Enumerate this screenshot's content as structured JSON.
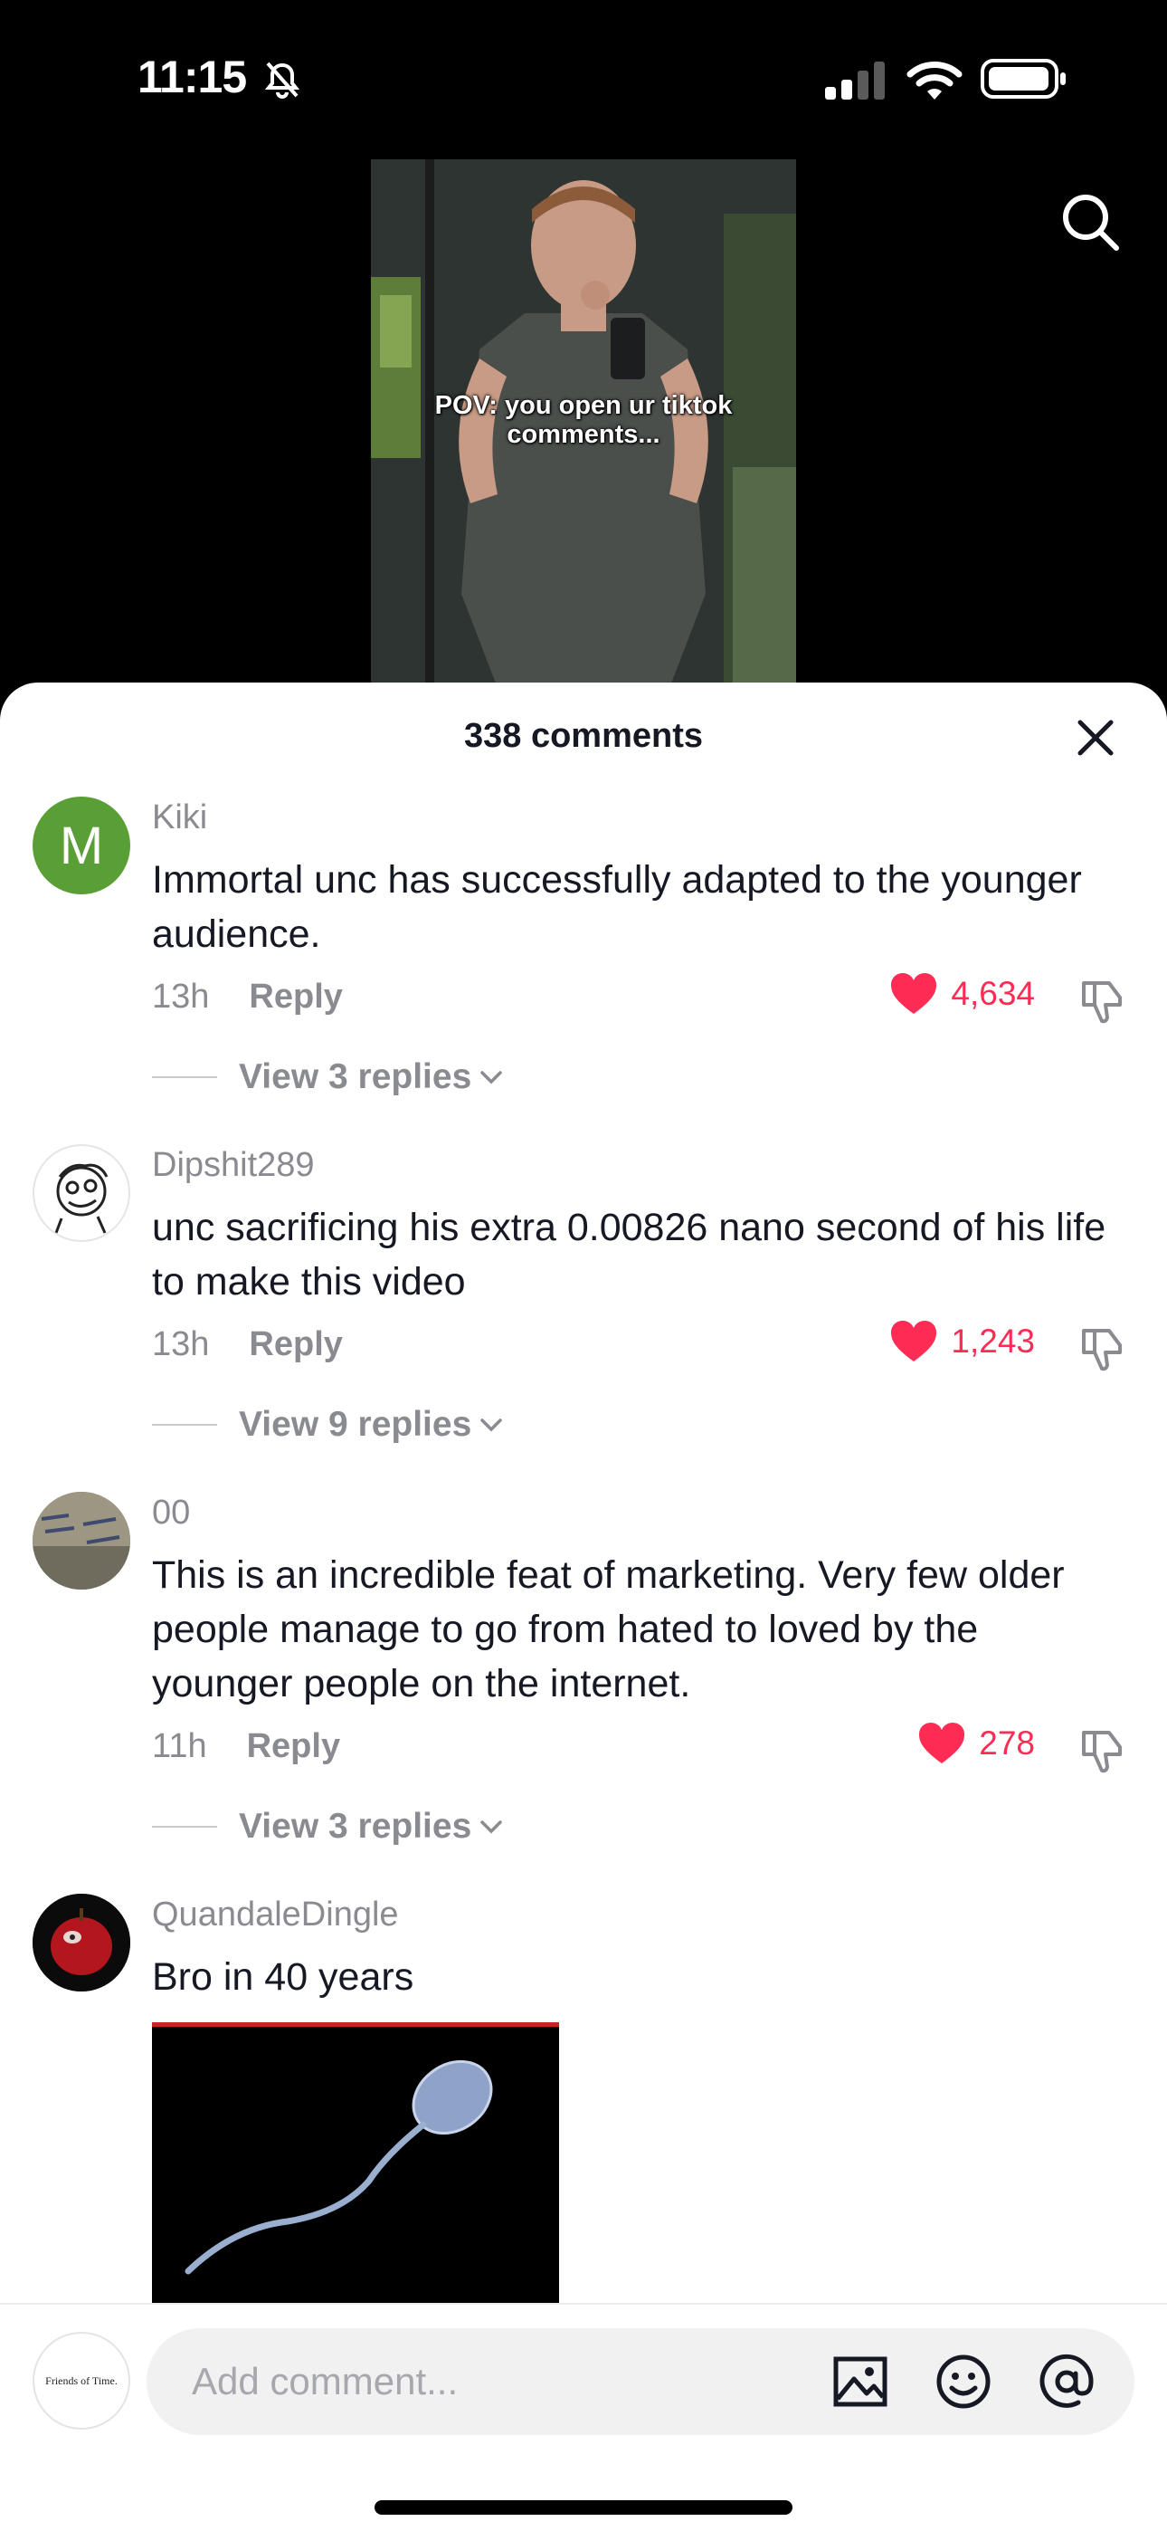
{
  "status_bar": {
    "time": "11:15"
  },
  "video": {
    "caption": "POV: you open ur tiktok comments..."
  },
  "sheet": {
    "title": "338 comments"
  },
  "comments": [
    {
      "username": "Kiki",
      "avatar_letter": "M",
      "avatar_color": "#5a9e36",
      "text": "Immortal unc has successfully adapted to the younger audience.",
      "age": "13h",
      "reply_label": "Reply",
      "likes": "4,634",
      "view_replies": "View 3 replies"
    },
    {
      "username": "Dipshit289",
      "text": "unc sacrificing his extra 0.00826 nano second of his life to make this video",
      "age": "13h",
      "reply_label": "Reply",
      "likes": "1,243",
      "view_replies": "View 9 replies"
    },
    {
      "username": "00",
      "text": "This is an incredible feat of marketing. Very few older people manage to go from hated to loved by the younger people on the internet.",
      "age": "11h",
      "reply_label": "Reply",
      "likes": "278",
      "view_replies": "View 3 replies"
    },
    {
      "username": "QuandaleDingle",
      "text": "Bro in 40 years"
    }
  ],
  "composer": {
    "avatar_text": "Friends of Time.",
    "placeholder": "Add comment..."
  },
  "colors": {
    "accent": "#fe2c55",
    "muted": "#8a8b91",
    "text": "#161823"
  },
  "icons": [
    "bell-slash-icon",
    "signal-icon",
    "wifi-icon",
    "battery-icon",
    "search-icon",
    "close-icon",
    "heart-icon",
    "dislike-icon",
    "chevron-down-icon",
    "image-icon",
    "emoji-icon",
    "at-icon"
  ]
}
